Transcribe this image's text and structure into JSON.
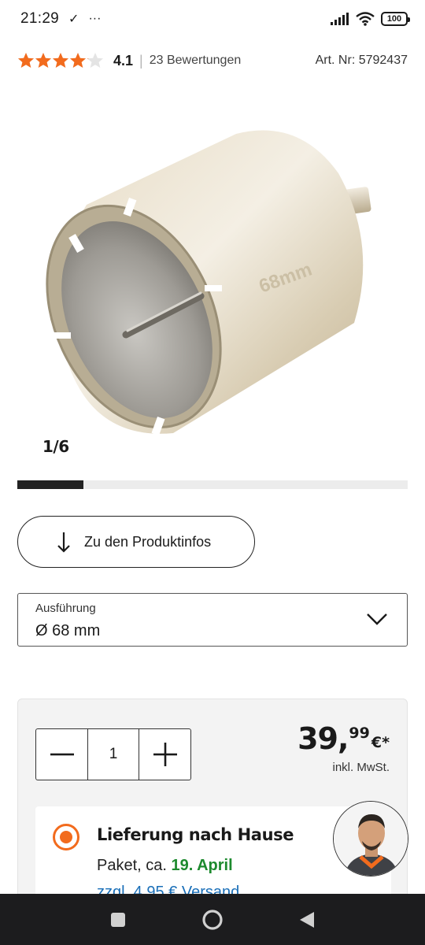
{
  "status_bar": {
    "time": "21:29",
    "check": "✓",
    "more": "···",
    "battery": "100"
  },
  "rating": {
    "value": "4.1",
    "separator": "|",
    "count_text": "23 Bewertungen",
    "stars_filled": 4.1,
    "stars_total": 5
  },
  "article_number": "Art. Nr: 5792437",
  "product_image": {
    "engraving": "68mm"
  },
  "gallery": {
    "counter": "1/6",
    "progress": 0.17
  },
  "info_button": {
    "label": "Zu den Produktinfos"
  },
  "variant": {
    "label": "Ausführung",
    "value": "Ø 68 mm"
  },
  "quantity": {
    "value": "1"
  },
  "price": {
    "euros": "39,",
    "cents": "99",
    "currency": "€*",
    "vat": "inkl. MwSt."
  },
  "delivery": {
    "title": "Lieferung nach Hause",
    "line_prefix": "Paket, ca.",
    "date": "19. April",
    "cost": "zzgl. 4,95 € Versand"
  },
  "colors": {
    "accent": "#f26b1d",
    "date_green": "#1d8a2e",
    "link_blue": "#1a6fb8",
    "star_orange": "#f26b1d"
  },
  "icons": {
    "wifi": "wifi-icon",
    "signal": "signal-icon",
    "nav_recent": "square-icon",
    "nav_home": "circle-icon",
    "nav_back": "triangle-back-icon"
  }
}
